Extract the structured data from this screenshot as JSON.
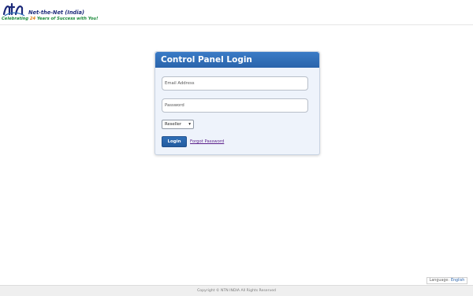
{
  "header": {
    "brand_name": "Net-the-Net (India)",
    "tagline_start": "Celebrating",
    "tagline_years": "24",
    "tagline_end": "Years of Success with You!",
    "logo_text": "ntn"
  },
  "login": {
    "title": "Control Panel Login",
    "email_placeholder": "Email Address",
    "password_placeholder": "Password",
    "role_selected": "Reseller",
    "login_button": "Login",
    "forgot_link": "Forgot Password"
  },
  "language": {
    "label": "Language:",
    "value": "English"
  },
  "footer": {
    "copyright": "Copyright © NTN INDIA All Rights Reserved"
  },
  "colors": {
    "accent": "#2a64ab",
    "brand_green": "#1b8a3a",
    "brand_orange": "#e07d10"
  }
}
